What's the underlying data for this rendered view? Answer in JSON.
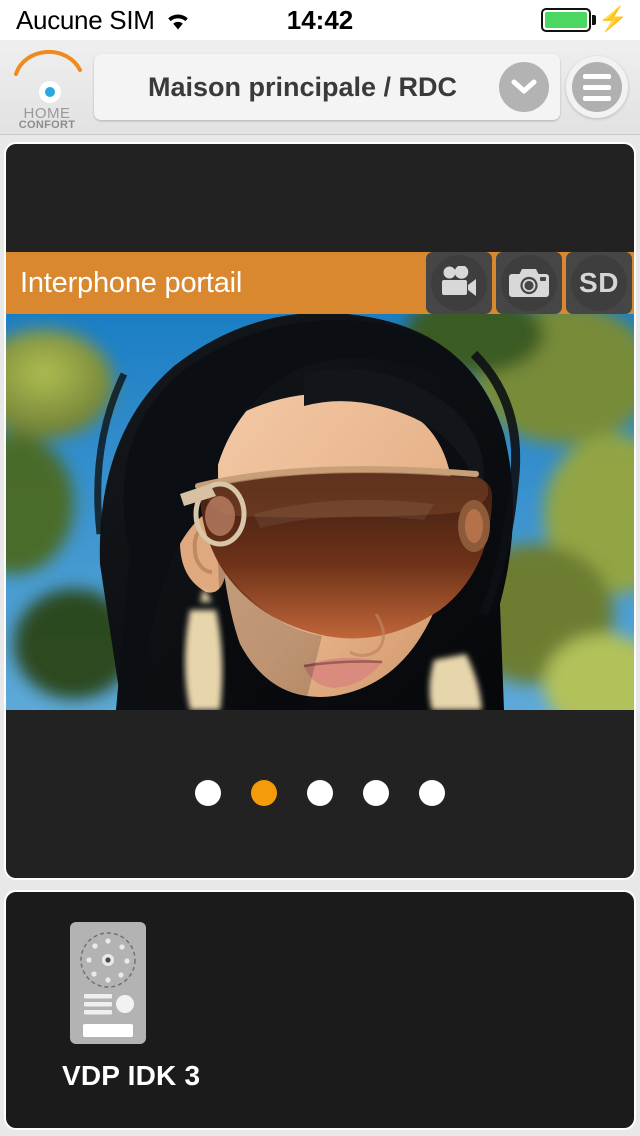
{
  "status_bar": {
    "carrier": "Aucune SIM",
    "wifi_icon": "wifi-icon",
    "time": "14:42",
    "battery_icon": "battery-full-icon",
    "charging_icon": "lightning-bolt-icon",
    "battery_color": "#4CD760"
  },
  "nav_bar": {
    "logo_name": "HOME",
    "logo_subtitle": "CONFORT",
    "location_title": "Maison principale / RDC",
    "dropdown_icon": "chevron-down-icon",
    "menu_icon": "hamburger-menu-icon"
  },
  "camera_card": {
    "title": "Interphone portail",
    "accent_color": "#D9882F",
    "buttons": [
      {
        "name": "video-record-button",
        "icon": "video-camera-icon",
        "label": ""
      },
      {
        "name": "snapshot-button",
        "icon": "photo-camera-icon",
        "label": ""
      },
      {
        "name": "sd-card-button",
        "icon": "sd-text-icon",
        "label": "SD"
      }
    ],
    "pagination": {
      "total": 5,
      "active_index": 1,
      "active_color": "#F59A0B",
      "inactive_color": "#FFFFFF"
    }
  },
  "device_card": {
    "devices": [
      {
        "name": "VDP IDK 3",
        "icon": "video-doorbell-icon"
      }
    ]
  }
}
